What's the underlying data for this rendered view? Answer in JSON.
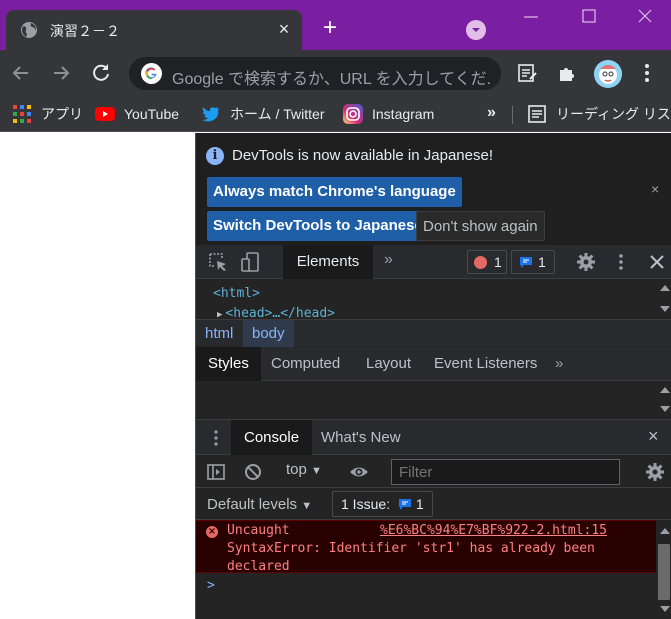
{
  "browser": {
    "tab_title": "演習２－２",
    "tab_close": "×",
    "new_tab": "+",
    "omnibox_placeholder": "Google で検索するか、URL を入力してくだ...",
    "colors": {
      "frame": "#7b1fa2",
      "toolbar": "#35363a"
    }
  },
  "bookmarks": {
    "items": [
      {
        "label": "アプリ",
        "icon": "apps-grid-icon"
      },
      {
        "label": "YouTube",
        "icon": "youtube-icon"
      },
      {
        "label": "ホーム / Twitter",
        "icon": "twitter-icon"
      },
      {
        "label": "Instagram",
        "icon": "instagram-icon"
      }
    ],
    "more": "»",
    "reading_list": "リーディング リスト"
  },
  "devtools": {
    "infobar": {
      "message": "DevTools is now available in Japanese!",
      "match_language": "Always match Chrome's language",
      "switch_language": "Switch DevTools to Japanese",
      "dont_show": "Don't show again",
      "close": "×"
    },
    "panel_tab": "Elements",
    "more_tabs": "»",
    "error_count": "1",
    "message_count": "1",
    "dom": {
      "html_tag": "<html>",
      "head_tag": "<head>…</head>"
    },
    "breadcrumbs": [
      "html",
      "body"
    ],
    "styles_tabs": [
      "Styles",
      "Computed",
      "Layout",
      "Event Listeners"
    ],
    "styles_more": "»",
    "drawer_tabs": {
      "console": "Console",
      "whats_new": "What's New"
    },
    "drawer_close": "×",
    "console": {
      "context": "top",
      "filter_placeholder": "Filter",
      "levels": "Default levels",
      "issues_label": "1 Issue:",
      "issues_count": "1",
      "error_line1": "Uncaught",
      "error_source": "%E6%BC%94%E7%BF%922-2.html:15",
      "error_line2": "SyntaxError: Identifier 'str1' has already been",
      "error_line3": "declared",
      "prompt": ">"
    }
  }
}
